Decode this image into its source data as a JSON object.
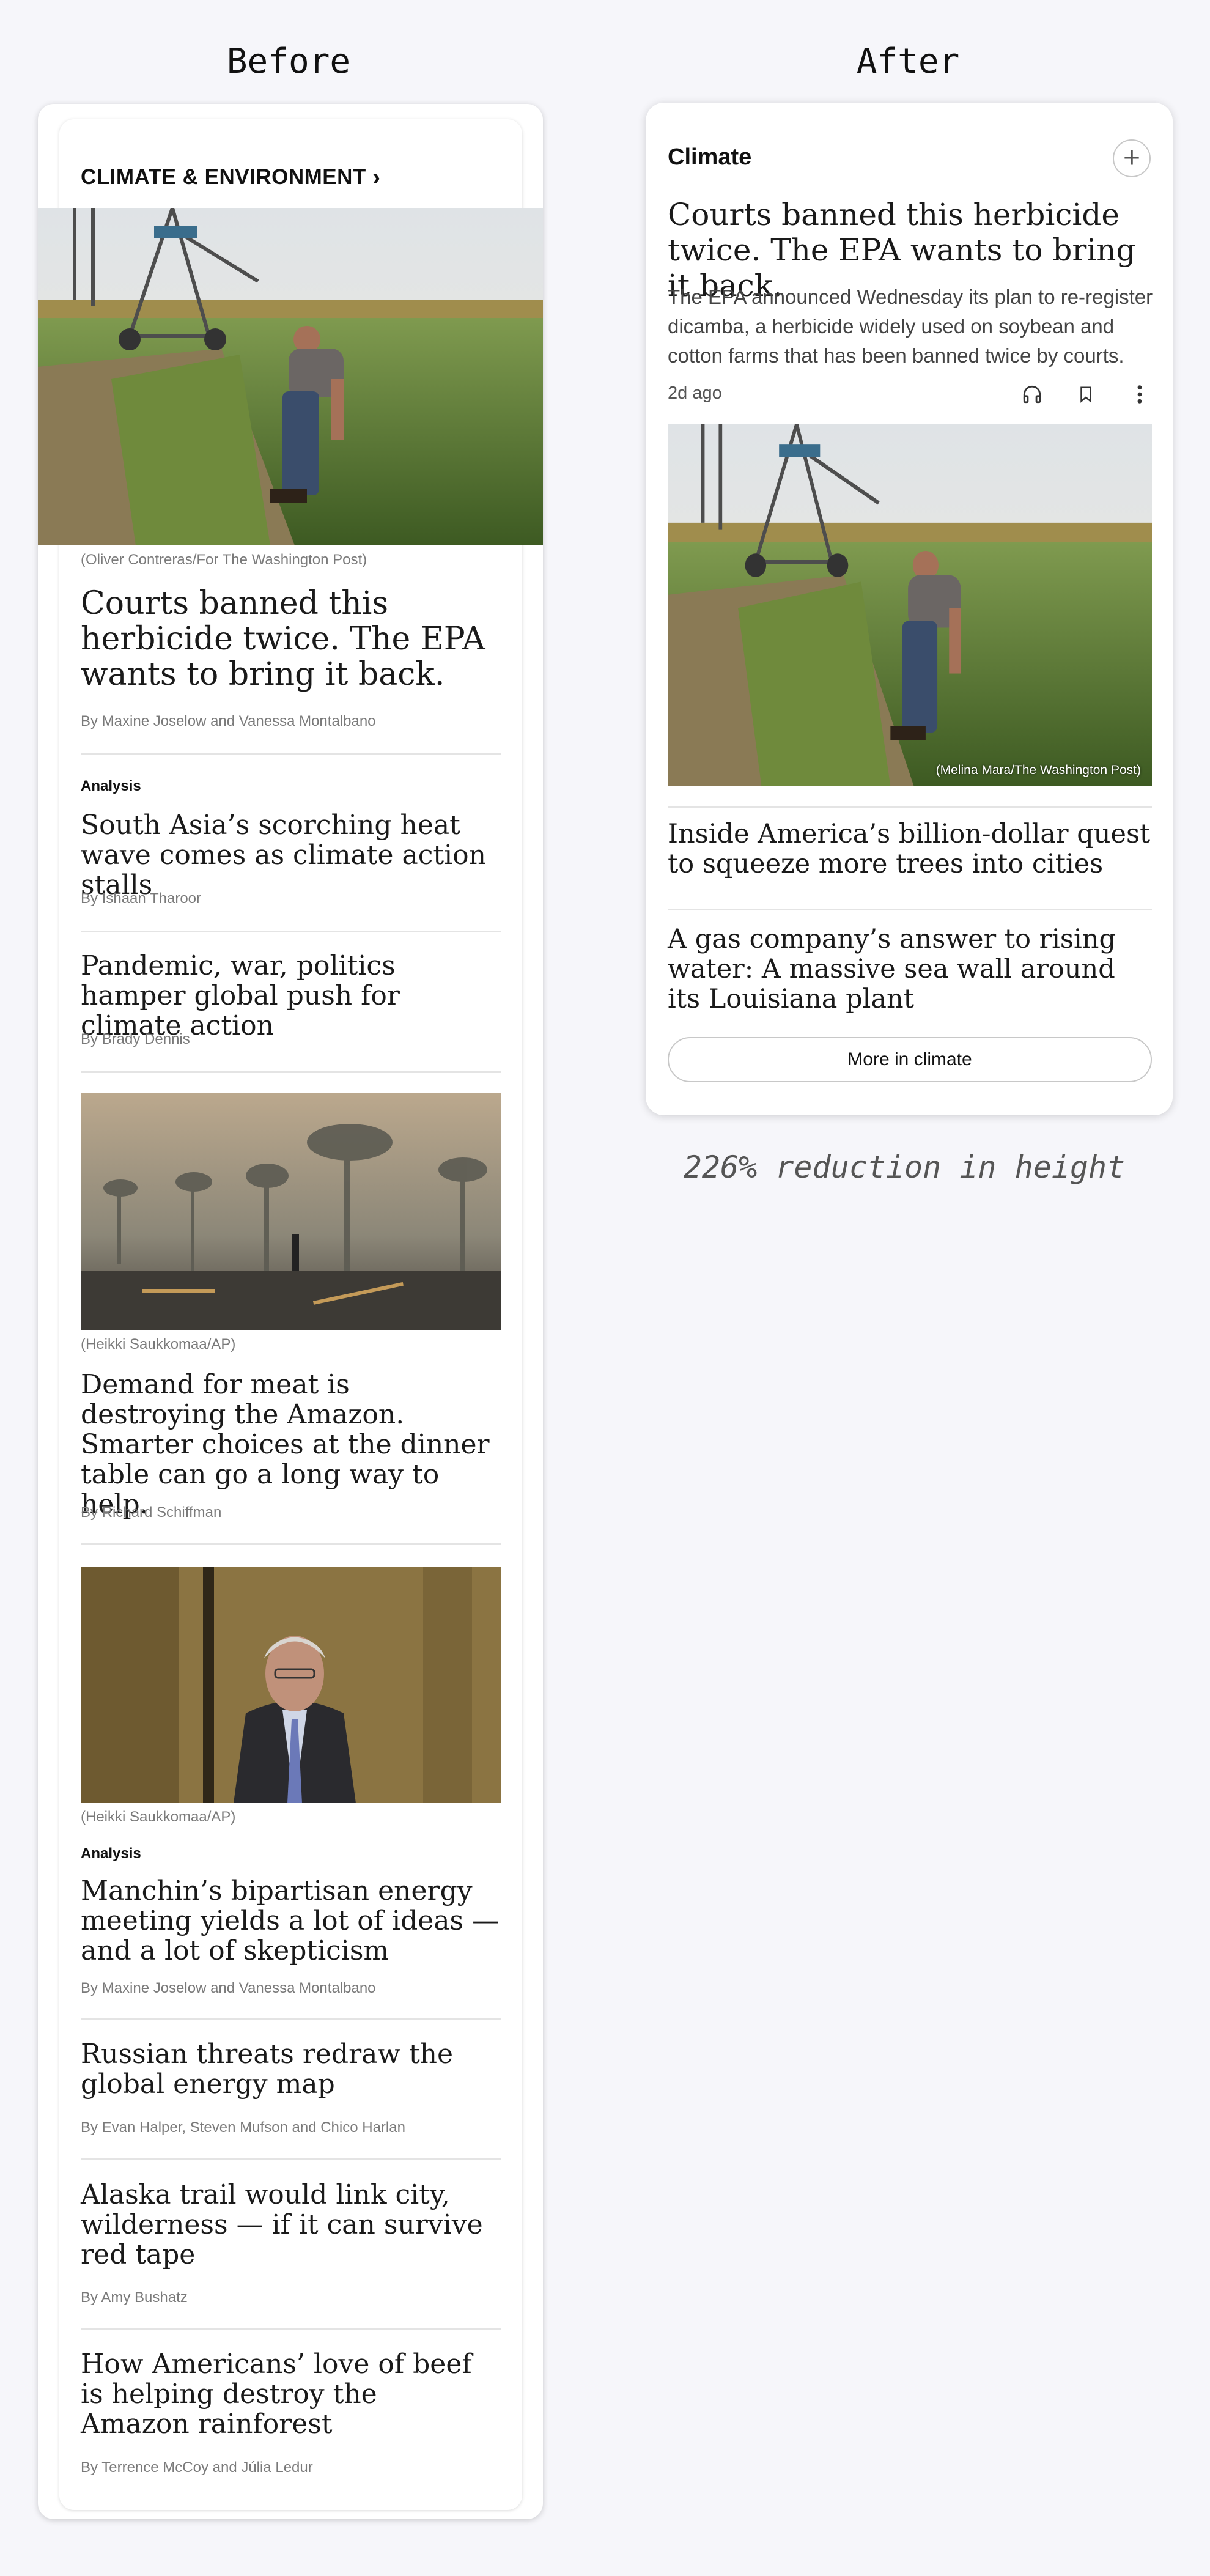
{
  "labels": {
    "before": "Before",
    "after": "After"
  },
  "before": {
    "section_title": "CLIMATE & ENVIRONMENT",
    "section_chevron": "›",
    "lead": {
      "caption": "(Oliver Contreras/For The Washington Post)",
      "headline": "Courts banned this herbicide twice. The EPA wants to bring it back.",
      "byline": "By Maxine Joselow and Vanessa Montalbano"
    },
    "story2": {
      "kicker": "Analysis",
      "headline": "South Asia’s scorching heat wave comes as climate action stalls",
      "byline": "By Ishaan Tharoor"
    },
    "story3": {
      "headline": "Pandemic, war, politics hamper global push for climate action",
      "byline": "By Brady Dennis"
    },
    "story4": {
      "caption": "(Heikki Saukkomaa/AP)",
      "headline": "Demand for meat is destroying the Amazon. Smarter choices at the dinner table can go a long way to help.",
      "byline": "By Richard Schiffman"
    },
    "story5": {
      "caption": "(Heikki Saukkomaa/AP)",
      "kicker": "Analysis",
      "headline": "Manchin’s bipartisan energy meeting yields a lot of ideas — and a lot of skepticism",
      "byline": "By Maxine Joselow and Vanessa Montalbano"
    },
    "story6": {
      "headline": "Russian threats redraw the global energy map",
      "byline": "By Evan Halper, Steven Mufson and Chico Harlan"
    },
    "story7": {
      "headline": "Alaska trail would link city, wilderness — if it can survive red tape",
      "byline": "By Amy Bushatz"
    },
    "story8": {
      "headline": "How Americans’ love of beef is helping destroy the Amazon rainforest",
      "byline": "By Terrence McCoy and Júlia Ledur"
    }
  },
  "after": {
    "section_title": "Climate",
    "add_label": "+",
    "lead": {
      "headline": "Courts banned this herbicide twice. The EPA wants to bring it back.",
      "blurb": "The EPA announced Wednesday its plan to re-register dicamba, a herbicide widely used on soybean and cotton farms that has been banned twice by courts.",
      "timestamp": "2d ago",
      "photo_credit": "(Melina Mara/The Washington Post)"
    },
    "story2": {
      "headline": "Inside America’s billion-dollar quest to squeeze more trees into cities"
    },
    "story3": {
      "headline": "A gas company’s answer to rising water: A massive sea wall around its Louisiana plant"
    },
    "more_button": "More in climate"
  },
  "reduction_text": "226% reduction in height",
  "icons": [
    "chevron-right-icon",
    "plus-icon",
    "headphones-icon",
    "bookmark-icon",
    "more-vertical-icon"
  ],
  "colors": {
    "background": "#f6f6fa",
    "card": "#ffffff",
    "byline": "#7a7a7a",
    "divider": "#e4e4e4"
  }
}
